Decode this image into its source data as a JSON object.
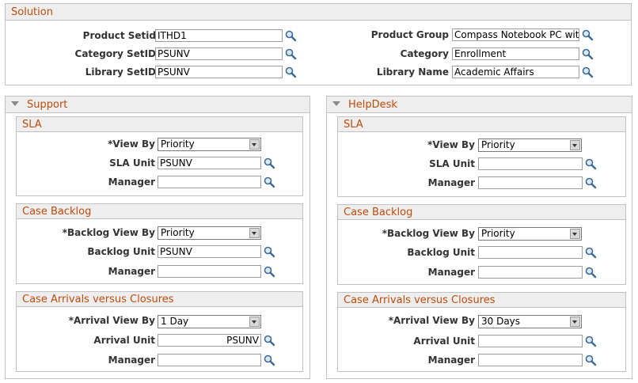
{
  "solution": {
    "title": "Solution",
    "product_setid": {
      "label": "Product Setid",
      "value": "ITHD1"
    },
    "category_setid": {
      "label": "Category SetID",
      "value": "PSUNV"
    },
    "library_setid": {
      "label": "Library SetID",
      "value": "PSUNV"
    },
    "product_group": {
      "label": "Product Group",
      "value": "Compass Notebook PC with"
    },
    "category": {
      "label": "Category",
      "value": "Enrollment"
    },
    "library_name": {
      "label": "Library Name",
      "value": "Academic Affairs"
    }
  },
  "support": {
    "title": "Support",
    "sla": {
      "title": "SLA",
      "view_by": {
        "label": "*View By",
        "value": "Priority"
      },
      "sla_unit": {
        "label": "SLA Unit",
        "value": "PSUNV"
      },
      "manager": {
        "label": "Manager",
        "value": ""
      }
    },
    "backlog": {
      "title": "Case Backlog",
      "view_by": {
        "label": "*Backlog View By",
        "value": "Priority"
      },
      "unit": {
        "label": "Backlog Unit",
        "value": "PSUNV"
      },
      "manager": {
        "label": "Manager",
        "value": ""
      }
    },
    "arrivals": {
      "title": "Case Arrivals versus Closures",
      "view_by": {
        "label": "*Arrival View By",
        "value": "1 Day"
      },
      "unit": {
        "label": "Arrival Unit",
        "value": "PSUNV"
      },
      "manager": {
        "label": "Manager",
        "value": ""
      }
    }
  },
  "helpdesk": {
    "title": "HelpDesk",
    "sla": {
      "title": "SLA",
      "view_by": {
        "label": "*View By",
        "value": "Priority"
      },
      "sla_unit": {
        "label": "SLA Unit",
        "value": ""
      },
      "manager": {
        "label": "Manager",
        "value": ""
      }
    },
    "backlog": {
      "title": "Case Backlog",
      "view_by": {
        "label": "*Backlog View By",
        "value": "Priority"
      },
      "unit": {
        "label": "Backlog Unit",
        "value": ""
      },
      "manager": {
        "label": "Manager",
        "value": ""
      }
    },
    "arrivals": {
      "title": "Case Arrivals versus Closures",
      "view_by": {
        "label": "*Arrival View By",
        "value": "30 Days"
      },
      "unit": {
        "label": "Arrival Unit",
        "value": ""
      },
      "manager": {
        "label": "Manager",
        "value": ""
      }
    }
  },
  "colors": {
    "accent": "#bf4b0c",
    "header_bg": "#eeeeee",
    "border": "#c2c2c2"
  },
  "icons": {
    "lookup": "lookup-magnifier-icon",
    "collapse": "collapse-arrow-icon",
    "dropdown": "chevron-down-icon"
  }
}
